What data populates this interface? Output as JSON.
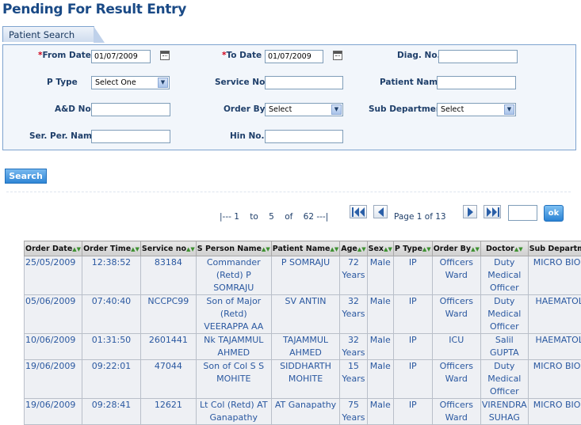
{
  "page": {
    "title": "Pending For Result Entry"
  },
  "tab": {
    "label": "Patient Search"
  },
  "form": {
    "from_date": {
      "label": "From Date",
      "required": "*",
      "value": "01/07/2009"
    },
    "to_date": {
      "label": "To Date",
      "required": "*",
      "value": "01/07/2009"
    },
    "diag_no": {
      "label": "Diag. No.",
      "value": ""
    },
    "p_type": {
      "label": "P Type",
      "selected": "Select One"
    },
    "service_no": {
      "label": "Service No.",
      "value": ""
    },
    "patient_name": {
      "label": "Patient Name",
      "value": ""
    },
    "and_no": {
      "label": "A&D No",
      "value": ""
    },
    "order_by": {
      "label": "Order By",
      "selected": "Select"
    },
    "sub_department": {
      "label": "Sub Department",
      "selected": "Select"
    },
    "ser_per_name": {
      "label": "Ser. Per. Name",
      "value": ""
    },
    "hin_no": {
      "label": "Hin No.",
      "value": ""
    }
  },
  "search_button": {
    "label": "Search"
  },
  "pager": {
    "range_text": "|--- 1    to    5    of    62 ---|",
    "page_text": "Page 1 of 13",
    "go_value": "",
    "ok_label": "ok"
  },
  "table": {
    "sort_marks": "▲▼",
    "columns": [
      "Order Date",
      "Order Time",
      "Service no",
      "S Person Name",
      "Patient Name",
      "Age",
      "Sex",
      "P Type",
      "Order By",
      "Doctor",
      "Sub Department"
    ],
    "rows": [
      [
        "25/05/2009",
        "12:38:52",
        "83184",
        "Commander (Retd) P SOMRAJU",
        "P SOMRAJU",
        "72 Years",
        "Male",
        "IP",
        "Officers Ward",
        "Duty Medical Officer",
        "MICRO BIOLOGY"
      ],
      [
        "05/06/2009",
        "07:40:40",
        "NCCPC99",
        "Son of Major (Retd) VEERAPPA AA",
        "SV ANTIN",
        "32 Years",
        "Male",
        "IP",
        "Officers Ward",
        "Duty Medical Officer",
        "HAEMATOLOGY"
      ],
      [
        "10/06/2009",
        "01:31:50",
        "2601441",
        "Nk TAJAMMUL AHMED",
        "TAJAMMUL AHMED",
        "32 Years",
        "Male",
        "IP",
        "ICU",
        "Salil GUPTA",
        "HAEMATOLOGY"
      ],
      [
        "19/06/2009",
        "09:22:01",
        "47044",
        "Son of Col S S MOHITE",
        "SIDDHARTH MOHITE",
        "15 Years",
        "Male",
        "IP",
        "Officers Ward",
        "Duty Medical Officer",
        "MICRO BIOLOGY"
      ],
      [
        "19/06/2009",
        "09:28:41",
        "12621",
        "Lt Col (Retd) AT Ganapathy",
        "AT Ganapathy",
        "75 Years",
        "Male",
        "IP",
        "Officers Ward",
        "VIRENDRA SUHAG",
        "MICRO BIOLOGY"
      ]
    ]
  },
  "colors": {
    "title": "#1a4a86",
    "accent": "#2f86d6",
    "label": "#1f3f6a",
    "cell_text": "#2a58a0"
  }
}
